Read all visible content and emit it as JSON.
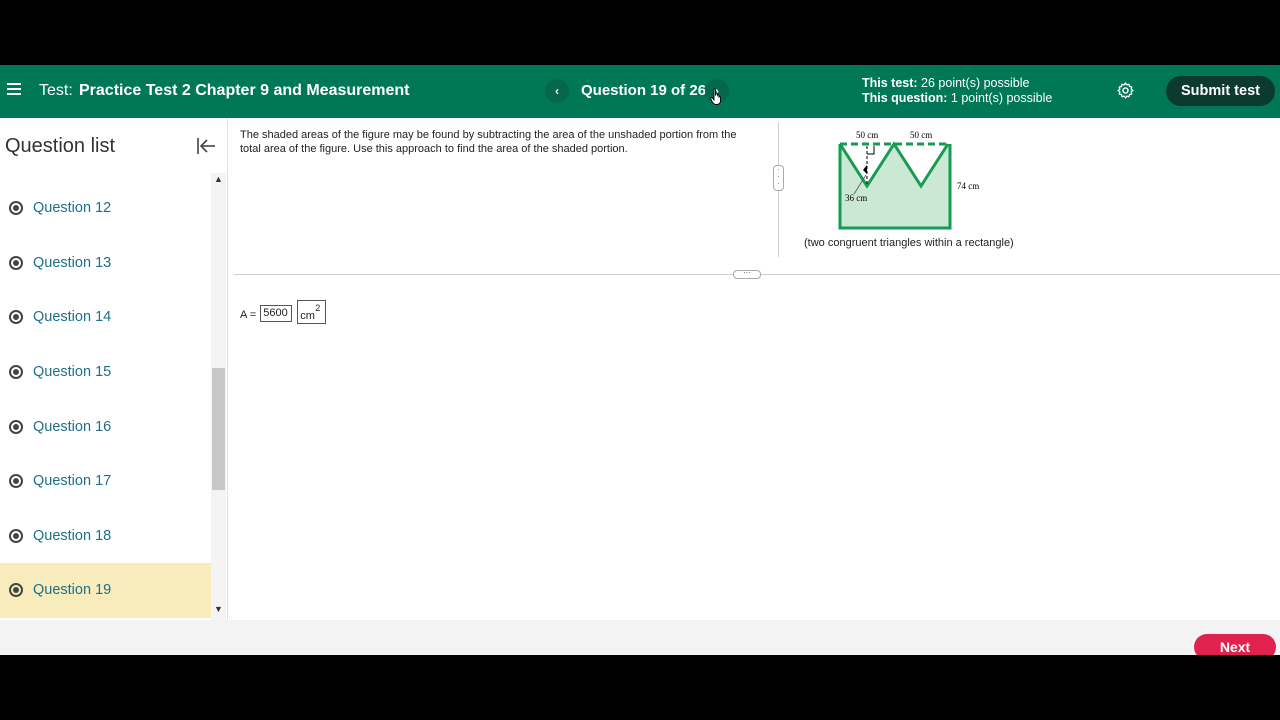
{
  "header": {
    "test_label": "Test:",
    "test_title": "Practice Test 2 Chapter 9 and Measurement",
    "prev_icon": "‹",
    "next_icon": "›",
    "question_indicator": "Question 19 of 26",
    "this_test_label": "This test:",
    "this_test_value": "26 point(s) possible",
    "this_question_label": "This question:",
    "this_question_value": "1 point(s) possible",
    "submit_label": "Submit test",
    "accent": "#007858"
  },
  "sidebar": {
    "title": "Question list",
    "items": [
      {
        "label": "Question 12"
      },
      {
        "label": "Question 13"
      },
      {
        "label": "Question 14"
      },
      {
        "label": "Question 15"
      },
      {
        "label": "Question 16"
      },
      {
        "label": "Question 17"
      },
      {
        "label": "Question 18"
      },
      {
        "label": "Question 19"
      }
    ],
    "active_label": "Question 19"
  },
  "question": {
    "prompt": "The shaded areas of the figure may be found by subtracting the area of the unshaded portion from the total area of the figure. Use this approach to find the area of the shaded portion.",
    "figure": {
      "top_left_label": "50 cm",
      "top_right_label": "50 cm",
      "right_label": "74 cm",
      "height_label": "36 cm",
      "caption": "(two congruent triangles within a rectangle)"
    }
  },
  "answer": {
    "prefix": "A =",
    "value": "5600",
    "unit": "cm",
    "unit_exponent": "2"
  },
  "footer": {
    "next_label": "Next"
  }
}
